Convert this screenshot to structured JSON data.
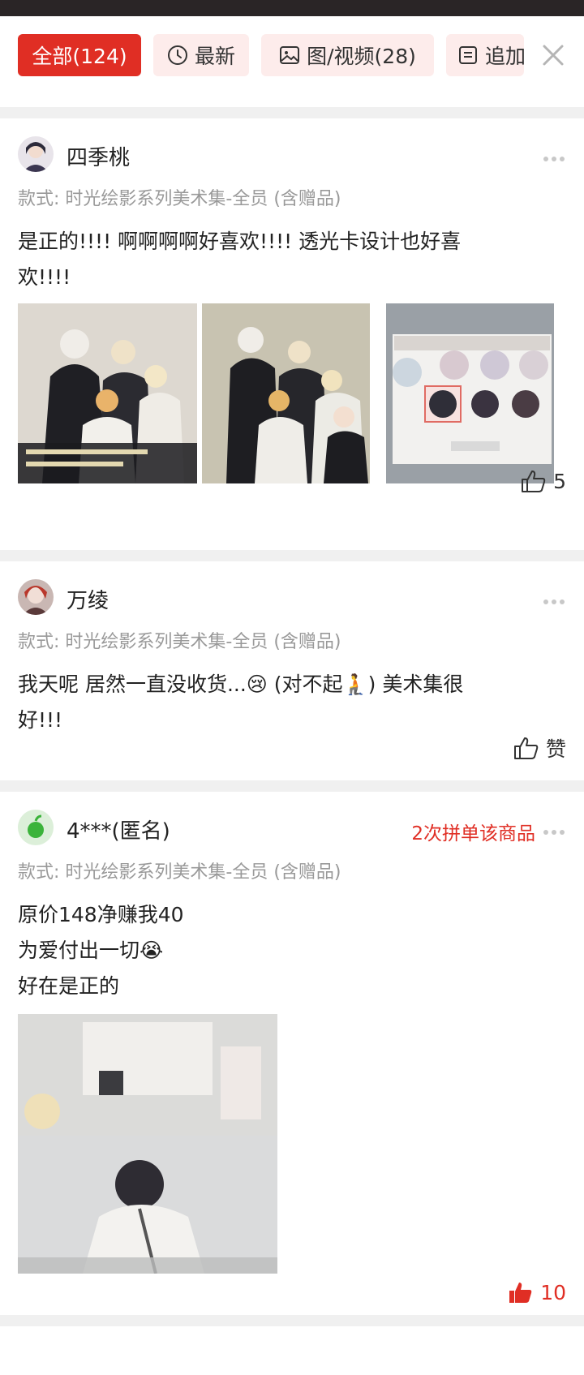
{
  "filters": [
    {
      "label": "全部(124)",
      "icon": "",
      "active": true
    },
    {
      "label": "最新",
      "icon": "clock-icon",
      "active": false
    },
    {
      "label": "图/视频(28)",
      "icon": "image-icon",
      "active": false
    },
    {
      "label": "追加",
      "icon": "note-icon",
      "active": false
    }
  ],
  "reviews": [
    {
      "user": "四季桃",
      "tag": "",
      "spec": "款式: 时光绘影系列美术集-全员 (含赠品)",
      "lines": [
        "是正的!!!! 啊啊啊啊好喜欢!!!! 透光卡设计也好喜",
        "欢!!!!"
      ],
      "likes": "5"
    },
    {
      "user": "万绫",
      "tag": "",
      "spec": "款式: 时光绘影系列美术集-全员 (含赠品)",
      "lines": [
        "我天呢 居然一直没收货...😢 (对不起🧎) 美术集很",
        "好!!!"
      ],
      "likes": "赞"
    },
    {
      "user": "4***(匿名)",
      "tag": "2次拼单该商品",
      "spec": "款式: 时光绘影系列美术集-全员 (含赠品)",
      "lines": [
        "原价148净赚我40",
        "为爱付出一切😭",
        "好在是正的"
      ],
      "likes": "10"
    }
  ],
  "colors": {
    "accent": "#e02e24",
    "chip_bg": "#fdeceb"
  }
}
